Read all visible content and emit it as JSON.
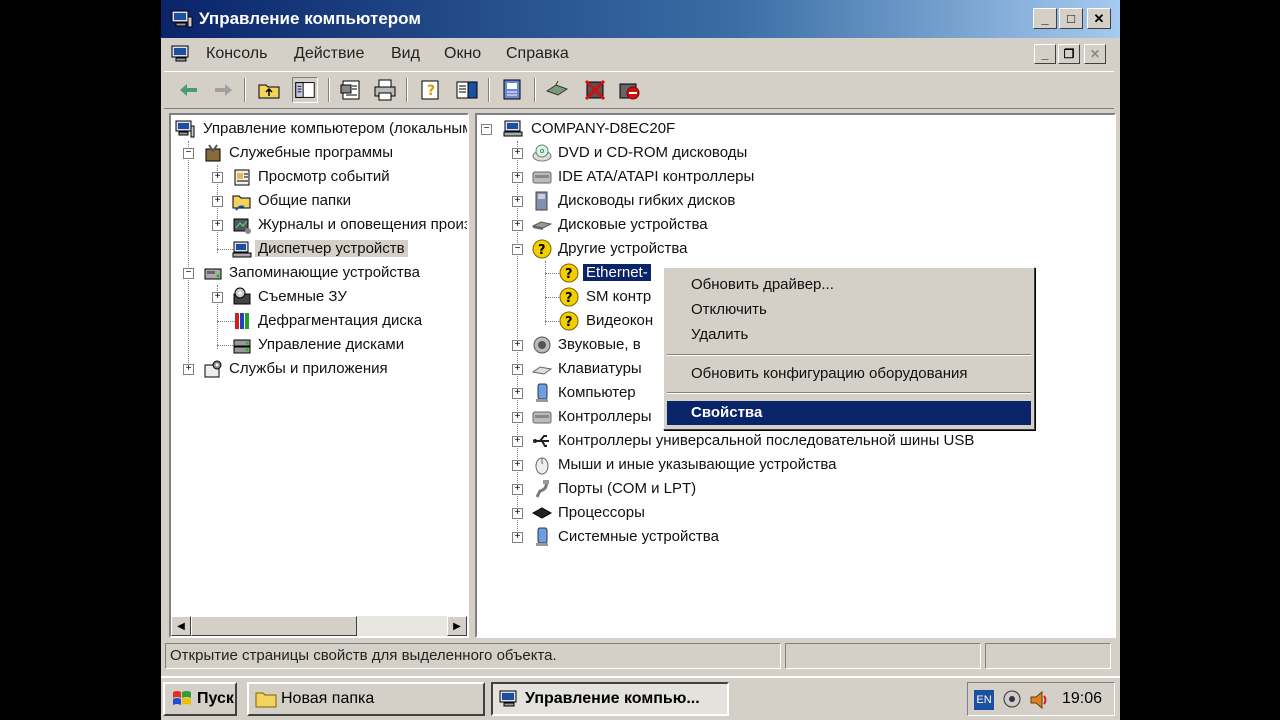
{
  "window": {
    "title": "Управление компьютером",
    "controls": {
      "minimize": "_",
      "maximize": "□",
      "close": "✕"
    }
  },
  "menu": {
    "items": [
      "Консоль",
      "Действие",
      "Вид",
      "Окно",
      "Справка"
    ],
    "mdi_controls": {
      "minimize": "_",
      "restore": "❐",
      "close": "✕"
    }
  },
  "left_tree": {
    "root": "Управление компьютером (локальным)",
    "nodes": [
      {
        "label": "Служебные программы"
      },
      {
        "label": "Просмотр событий"
      },
      {
        "label": "Общие папки"
      },
      {
        "label": "Журналы и оповещения производительности"
      },
      {
        "label": "Диспетчер устройств"
      },
      {
        "label": "Запоминающие устройства"
      },
      {
        "label": "Съемные ЗУ"
      },
      {
        "label": "Дефрагментация диска"
      },
      {
        "label": "Управление дисками"
      },
      {
        "label": "Службы и приложения"
      }
    ]
  },
  "right_tree": {
    "root": "COMPANY-D8EC20F",
    "nodes": [
      {
        "label": "DVD и CD-ROM дисководы"
      },
      {
        "label": "IDE ATA/ATAPI контроллеры"
      },
      {
        "label": "Дисководы гибких дисков"
      },
      {
        "label": "Дисковые устройства"
      },
      {
        "label": "Другие устройства"
      },
      {
        "label": "Ethernet-"
      },
      {
        "label": "SM контр"
      },
      {
        "label": "Видеокон"
      },
      {
        "label": "Звуковые, в"
      },
      {
        "label": "Клавиатуры"
      },
      {
        "label": "Компьютер"
      },
      {
        "label": "Контроллеры"
      },
      {
        "label": "Контроллеры универсальной последовательной шины USB"
      },
      {
        "label": "Мыши и иные указывающие устройства"
      },
      {
        "label": "Порты (COM и LPT)"
      },
      {
        "label": "Процессоры"
      },
      {
        "label": "Системные устройства"
      }
    ]
  },
  "context_menu": {
    "items": [
      "Обновить драйвер...",
      "Отключить",
      "Удалить",
      "Обновить конфигурацию оборудования",
      "Свойства"
    ]
  },
  "statusbar": {
    "text": "Открытие страницы свойств для выделенного объекта."
  },
  "taskbar": {
    "start": "Пуск",
    "buttons": [
      "Новая папка",
      "Управление компью..."
    ],
    "lang": "EN",
    "clock": "19:06"
  },
  "tree_expander": {
    "plus": "+",
    "minus": "−"
  },
  "scroll": {
    "left": "◀",
    "right": "▶"
  },
  "colors": {
    "title_start": "#0a246a",
    "title_end": "#a6caf0",
    "face": "#d4d0c8",
    "highlight": "#0a246a",
    "warning": "#f2d000"
  }
}
